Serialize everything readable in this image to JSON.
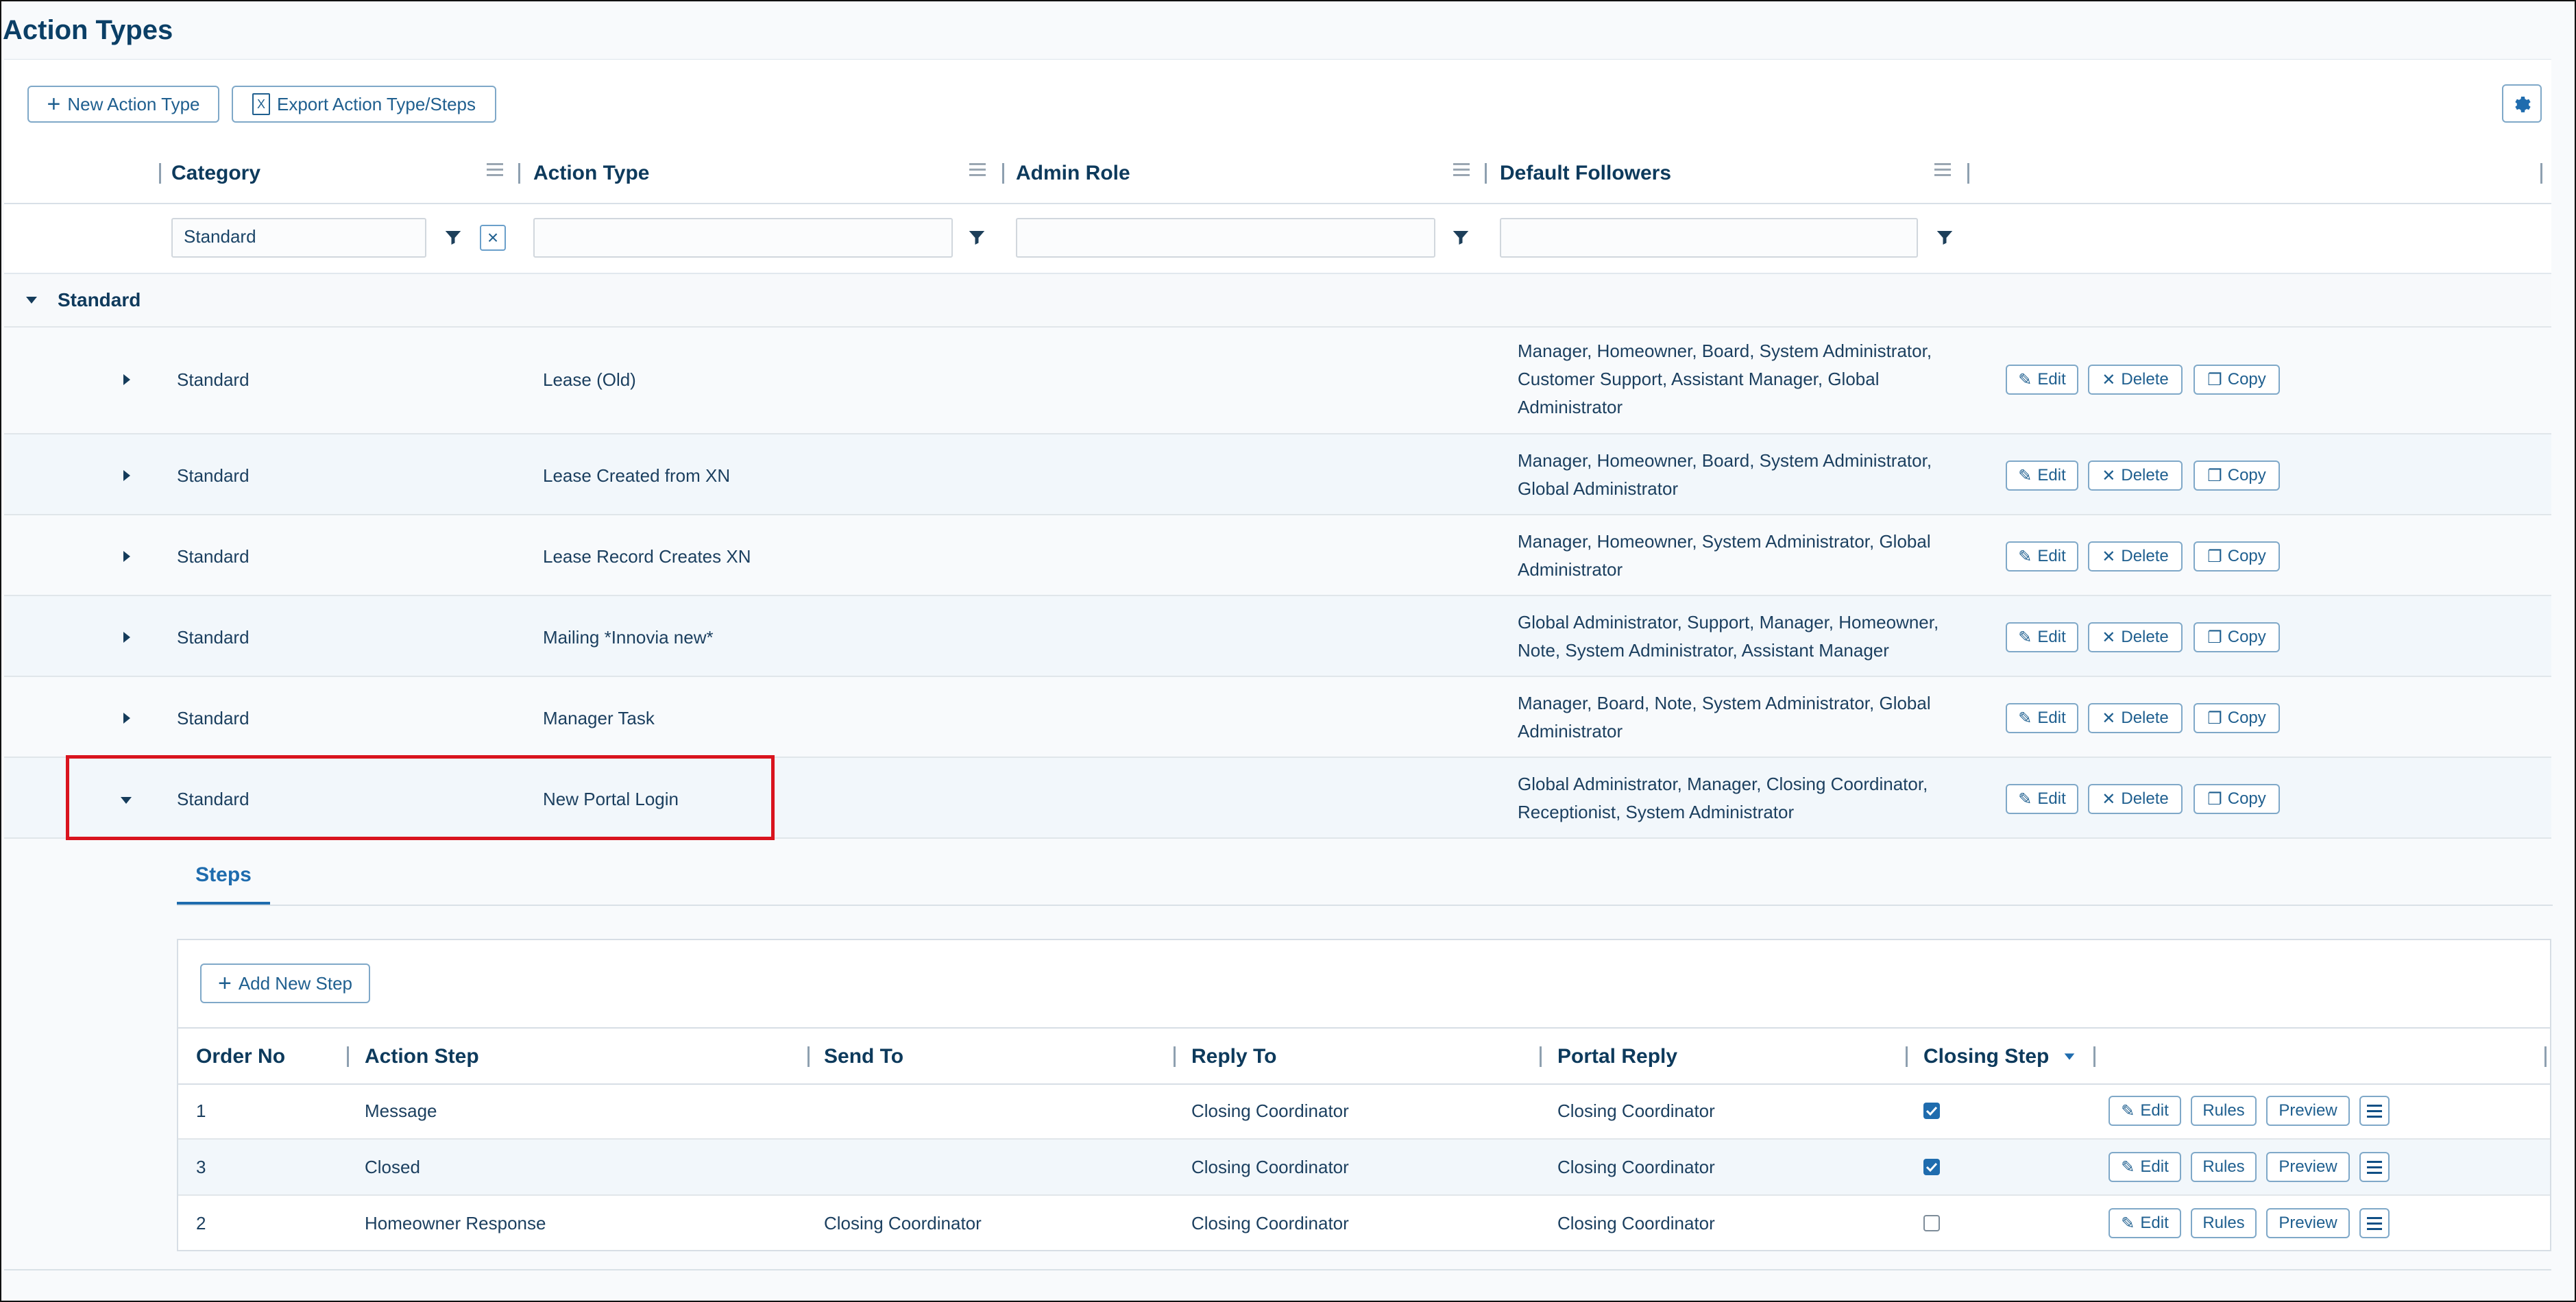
{
  "page": {
    "title": "Action Types"
  },
  "toolbar": {
    "new_action_type": "New Action Type",
    "export": "Export Action Type/Steps",
    "settings_icon": "gear-icon"
  },
  "grid": {
    "columns": [
      "Category",
      "Action Type",
      "Admin Role",
      "Default Followers"
    ],
    "filters": {
      "category": "Standard",
      "action_type": "",
      "admin_role": "",
      "default_followers": ""
    },
    "group_label": "Standard",
    "rows": [
      {
        "category": "Standard",
        "action_type": "Lease (Old)",
        "admin_role": "",
        "followers": [
          "Manager, Homeowner, Board, System Administrator,",
          "Customer Support, Assistant Manager, Global",
          "Administrator"
        ],
        "expanded": false
      },
      {
        "category": "Standard",
        "action_type": "Lease Created from XN",
        "admin_role": "",
        "followers": [
          "Manager, Homeowner, Board, System Administrator,",
          "Global Administrator"
        ],
        "expanded": false
      },
      {
        "category": "Standard",
        "action_type": "Lease Record Creates XN",
        "admin_role": "",
        "followers": [
          "Manager, Homeowner, System Administrator, Global",
          "Administrator"
        ],
        "expanded": false
      },
      {
        "category": "Standard",
        "action_type": "Mailing *Innovia new*",
        "admin_role": "",
        "followers": [
          "Global Administrator, Support, Manager, Homeowner,",
          "Note, System Administrator, Assistant Manager"
        ],
        "expanded": false
      },
      {
        "category": "Standard",
        "action_type": "Manager Task",
        "admin_role": "",
        "followers": [
          "Manager, Board, Note, System Administrator, Global",
          "Administrator"
        ],
        "expanded": false
      },
      {
        "category": "Standard",
        "action_type": "New Portal Login",
        "admin_role": "",
        "followers": [
          "Global Administrator, Manager, Closing Coordinator,",
          "Receptionist, System Administrator"
        ],
        "expanded": true
      }
    ],
    "actions": {
      "edit": "Edit",
      "delete": "Delete",
      "copy": "Copy"
    }
  },
  "steps": {
    "tab_label": "Steps",
    "add_new_step": "Add New Step",
    "columns": [
      "Order No",
      "Action Step",
      "Send To",
      "Reply To",
      "Portal Reply",
      "Closing Step"
    ],
    "rows": [
      {
        "order_no": "1",
        "action_step": "Message",
        "send_to": "",
        "reply_to": "Closing Coordinator",
        "portal_reply": "Closing Coordinator",
        "closing_step": true
      },
      {
        "order_no": "3",
        "action_step": "Closed",
        "send_to": "",
        "reply_to": "Closing Coordinator",
        "portal_reply": "Closing Coordinator",
        "closing_step": true
      },
      {
        "order_no": "2",
        "action_step": "Homeowner Response",
        "send_to": "Closing Coordinator",
        "reply_to": "Closing Coordinator",
        "portal_reply": "Closing Coordinator",
        "closing_step": false
      }
    ],
    "actions": {
      "edit": "Edit",
      "rules": "Rules",
      "preview": "Preview"
    }
  }
}
